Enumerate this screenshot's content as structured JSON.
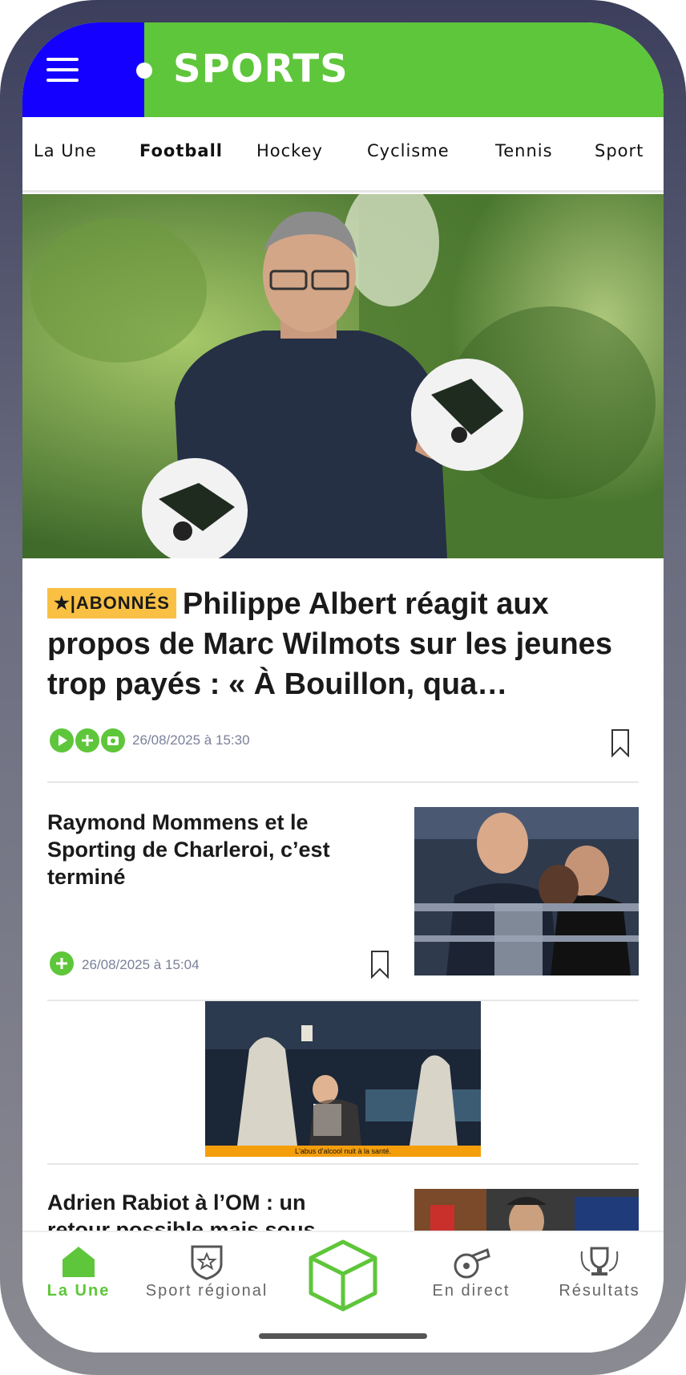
{
  "header": {
    "logo_text": "SPORTS"
  },
  "categories": [
    "La Une",
    "Football",
    "Hockey",
    "Cyclisme",
    "Tennis",
    "Sport"
  ],
  "active_category": "Football",
  "hero": {
    "badge": "★|ABONNÉS",
    "title": "Philippe Albert réagit aux propos de Marc Wilmots sur les jeunes trop payés : « À Bouillon, qua…",
    "date": "26/08/2025 à 15:30"
  },
  "article2": {
    "title": "Raymond Mommens et le Sporting de Charleroi, c’est terminé",
    "date": "26/08/2025 à 15:04"
  },
  "ad": {
    "caption": "L'abus d'alcool nuit à la santé."
  },
  "article3": {
    "title": "Adrien Rabiot à l’OM : un retour possible mais sous conditions"
  },
  "bottom_nav": {
    "home": "La Une",
    "regional": "Sport régional",
    "live": "En direct",
    "results": "Résultats"
  },
  "colors": {
    "brand_green": "#5ec63a",
    "brand_blue": "#1400ff",
    "badge_yellow": "#f9c043"
  }
}
